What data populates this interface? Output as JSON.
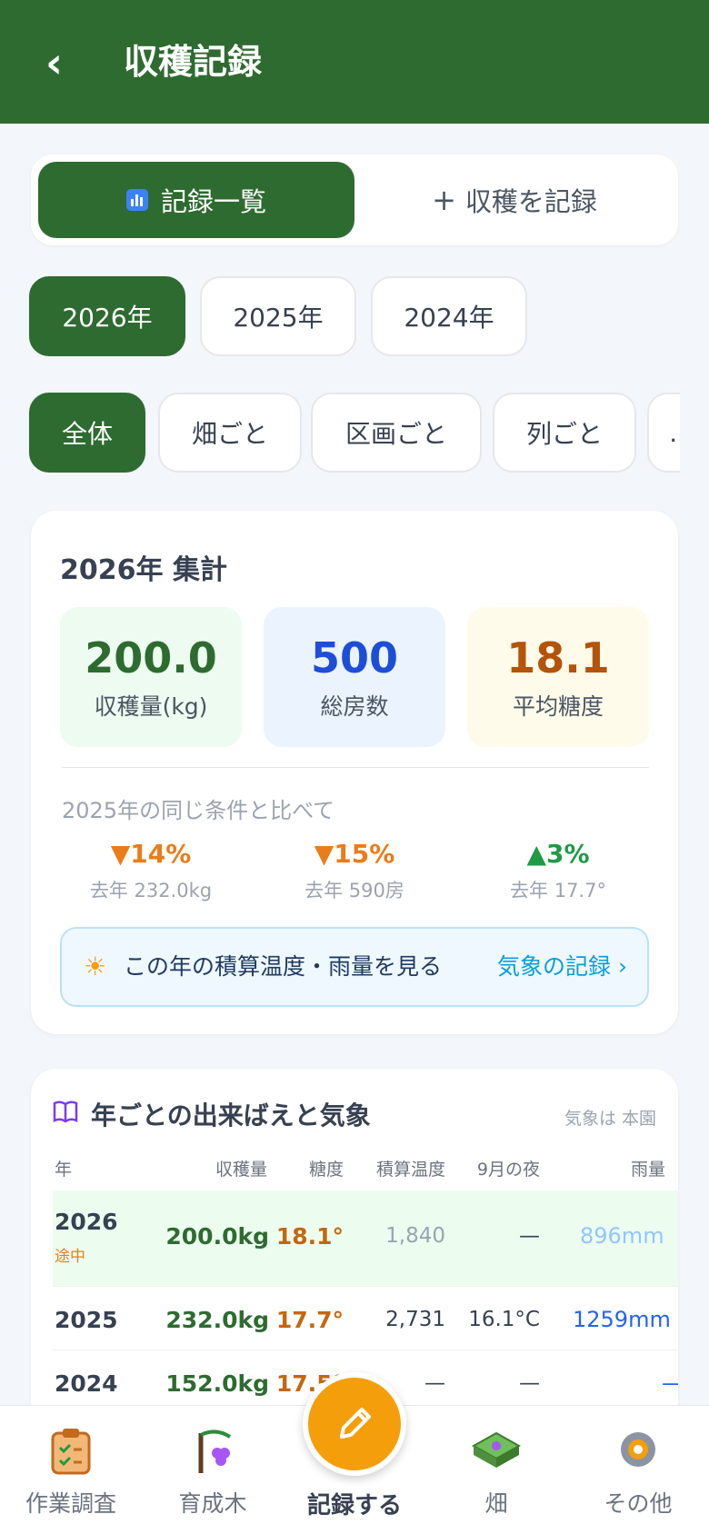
{
  "header": {
    "back_icon": "‹",
    "title": "収穫記録"
  },
  "segment": {
    "list_label": "記録一覧",
    "add_icon": "+",
    "add_label": "収穫を記録"
  },
  "years": [
    "2026年",
    "2025年",
    "2024年"
  ],
  "groupings": [
    "全体",
    "畑ごと",
    "区画ごと",
    "列ごと",
    "…"
  ],
  "summary": {
    "title": "2026年 集計",
    "stats": [
      {
        "value": "200.0",
        "label": "収穫量(kg)",
        "color": "#2e6b30",
        "bg": "#eefbf1"
      },
      {
        "value": "500",
        "label": "総房数",
        "color": "#1d4ed8",
        "bg": "#ebf4fe"
      },
      {
        "value": "18.1",
        "label": "平均糖度",
        "color": "#b45309",
        "bg": "#fefbea"
      }
    ],
    "compare_title": "2025年の同じ条件と比べて",
    "compare": [
      {
        "delta": "▼14%",
        "prev": "去年 232.0kg",
        "dir": "down"
      },
      {
        "delta": "▼15%",
        "prev": "去年 590房",
        "dir": "down"
      },
      {
        "delta": "▲3%",
        "prev": "去年 17.7°",
        "dir": "up"
      }
    ],
    "weather_icon": "☀",
    "weather_text": "この年の積算温度・雨量を見る",
    "weather_link": "気象の記録 ›"
  },
  "yearly": {
    "title": "年ごとの出来ばえと気象",
    "note": "気象は 本園",
    "headers": [
      "年",
      "収穫量",
      "糖度",
      "積算温度",
      "9月の夜",
      "雨量"
    ],
    "rows": [
      {
        "year": "2026",
        "tag": "途中",
        "amount": "200.0kg",
        "sugar": "18.1°",
        "gdd": "1,840",
        "night": "—",
        "rain": "896mm"
      },
      {
        "year": "2025",
        "tag": "",
        "amount": "232.0kg",
        "sugar": "17.7°",
        "gdd": "2,731",
        "night": "16.1°C",
        "rain": "1259mm"
      },
      {
        "year": "2024",
        "tag": "",
        "amount": "152.0kg",
        "sugar": "17.5°",
        "gdd": "—",
        "night": "—",
        "rain": "—"
      }
    ]
  },
  "tabbar": {
    "tabs": [
      "作業調査",
      "育成木",
      "記録する",
      "畑",
      "その他"
    ]
  }
}
